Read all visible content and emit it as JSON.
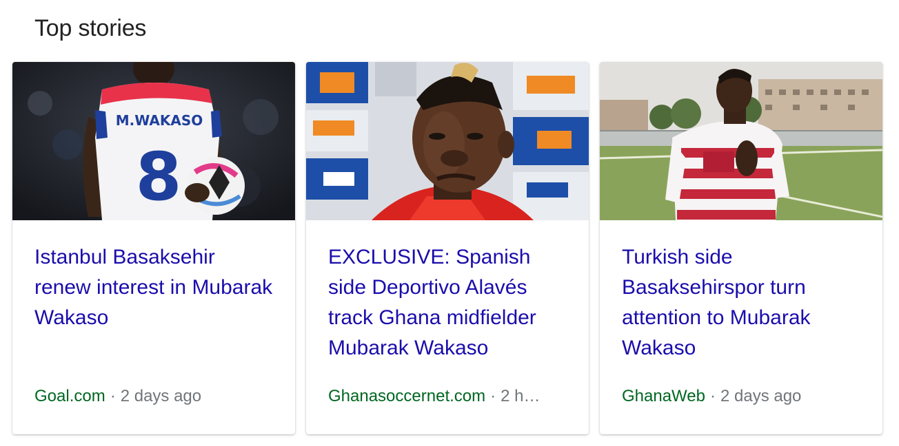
{
  "section": {
    "title": "Top stories"
  },
  "stories": [
    {
      "headline": "Istanbul Basaksehir renew interest in Mubarak Wakaso",
      "source": "Goal.com",
      "separator": "·",
      "age": "2 days ago",
      "image": {
        "jersey_text": "M.WAKASO",
        "jersey_number": "8"
      }
    },
    {
      "headline": "EXCLUSIVE: Spanish side Deportivo Alavés track Ghana midfielder Mubarak Wakaso",
      "source": "Ghanasoccernet.com",
      "separator": "·",
      "age": "2 h…"
    },
    {
      "headline": "Turkish side Basaksehirspor turn attention to Mubarak Wakaso",
      "source": "GhanaWeb",
      "separator": "·",
      "age": "2 days ago"
    }
  ],
  "colors": {
    "headline": "#1a0dab",
    "source": "#006621",
    "muted": "#70757a"
  }
}
